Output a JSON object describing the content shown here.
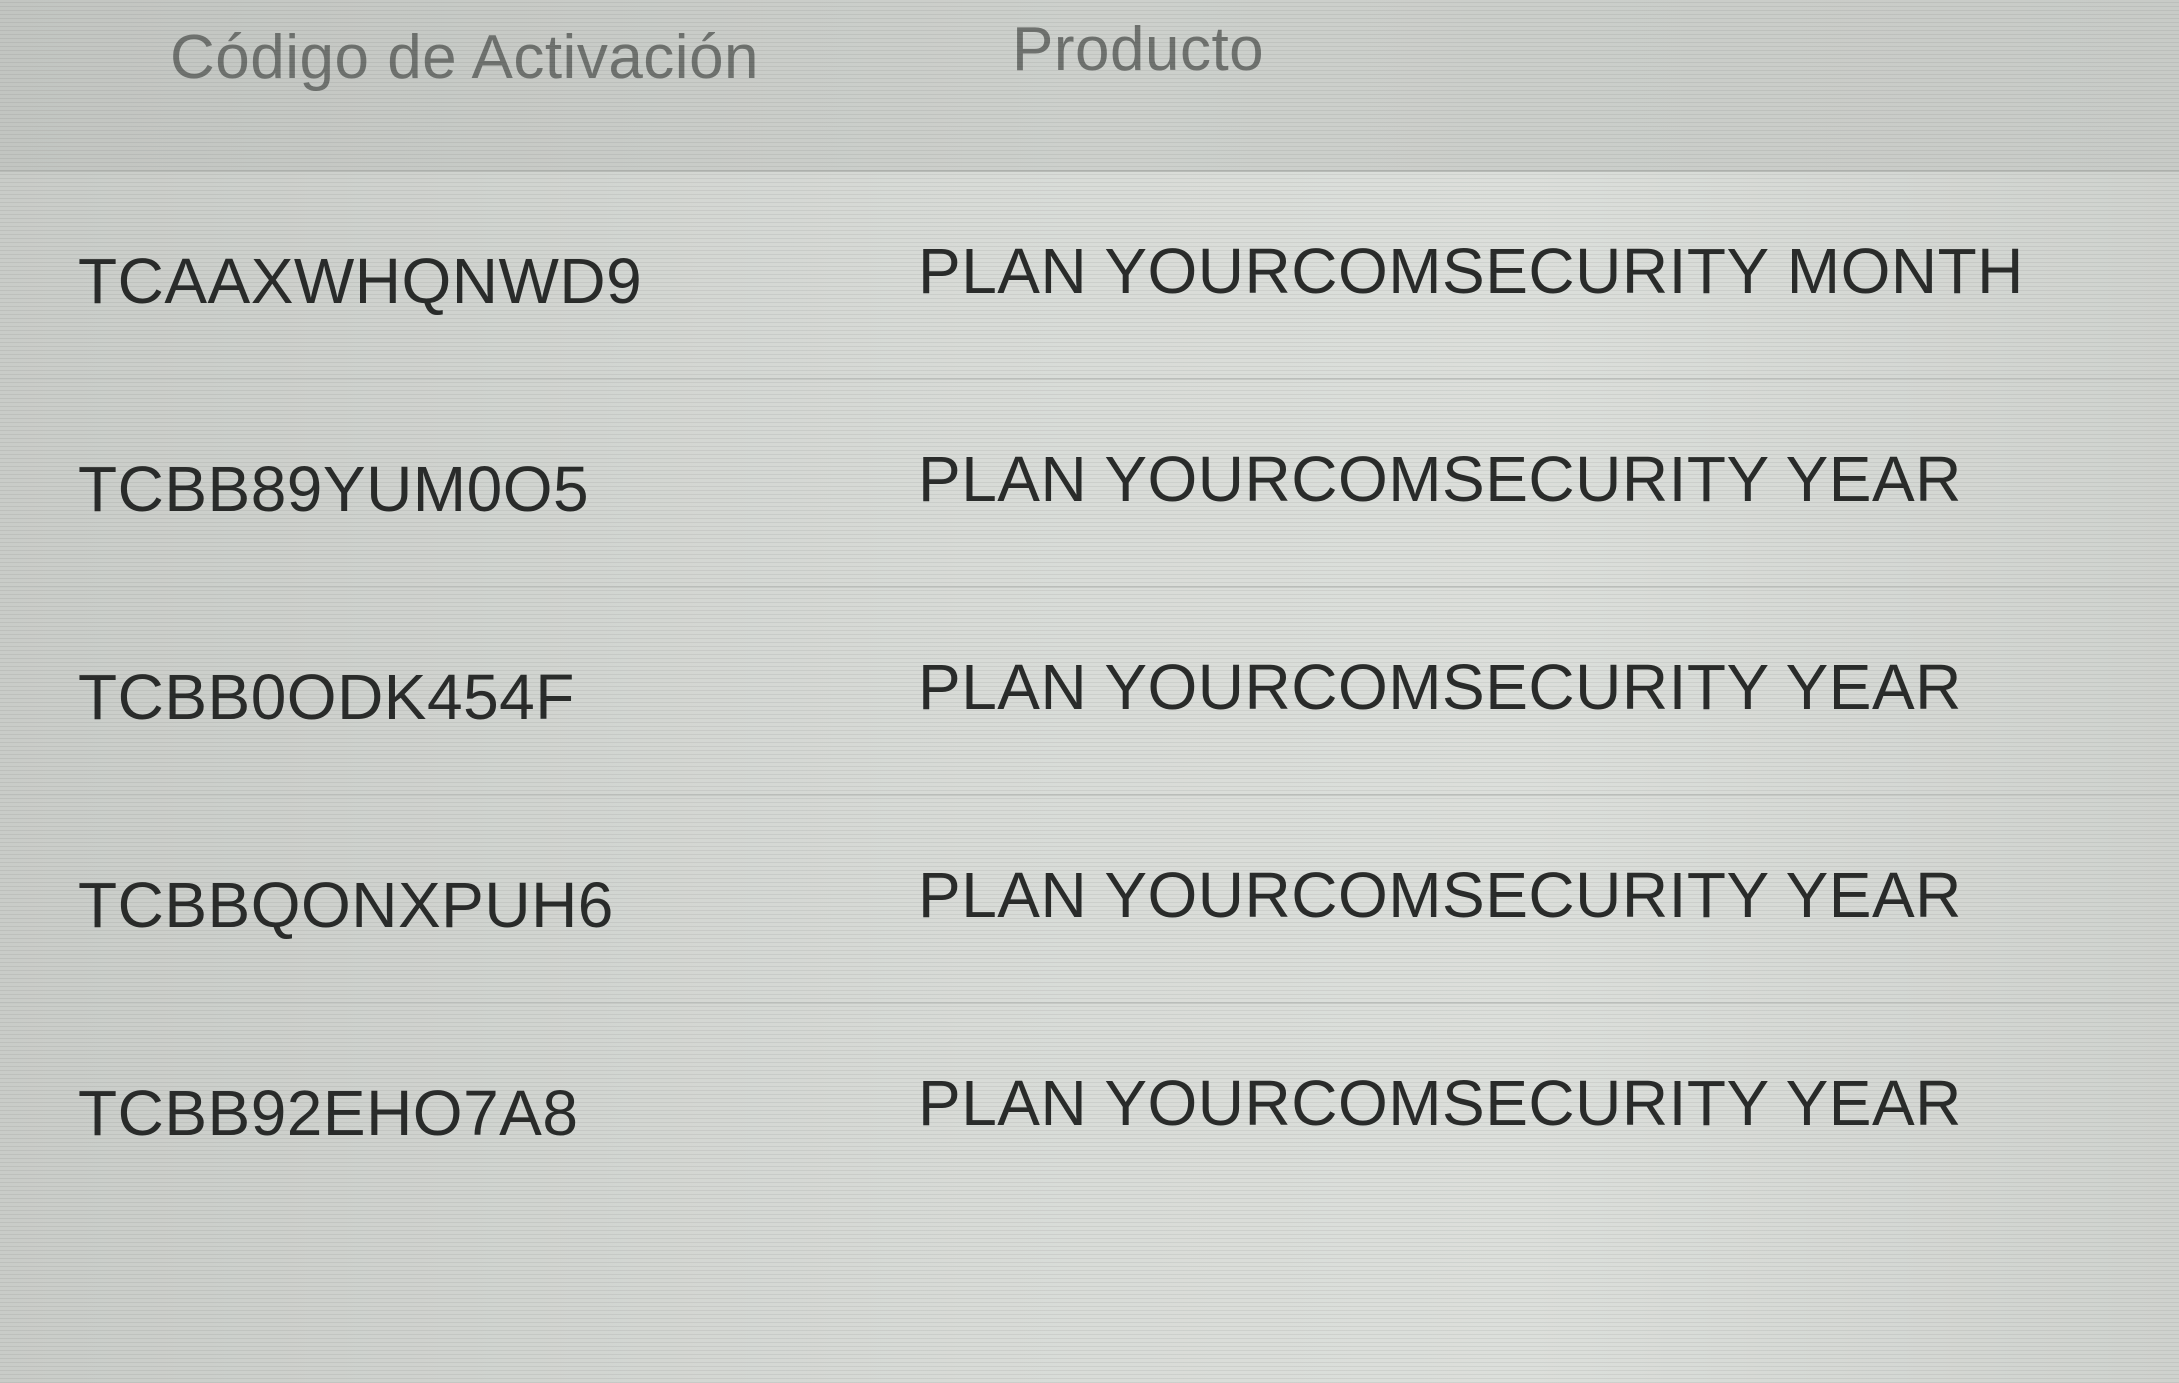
{
  "table": {
    "headers": {
      "code": "Código de Activación",
      "product": "Producto"
    },
    "rows": [
      {
        "code": "TCAAXWHQNWD9",
        "product": "PLAN YOURCOMSECURITY MONTH"
      },
      {
        "code": "TCBB89YUM0O5",
        "product": "PLAN YOURCOMSECURITY YEAR"
      },
      {
        "code": "TCBB0ODK454F",
        "product": "PLAN YOURCOMSECURITY YEAR"
      },
      {
        "code": "TCBBQONXPUH6",
        "product": "PLAN YOURCOMSECURITY YEAR"
      },
      {
        "code": "TCBB92EHO7A8",
        "product": "PLAN YOURCOMSECURITY YEAR"
      }
    ]
  }
}
